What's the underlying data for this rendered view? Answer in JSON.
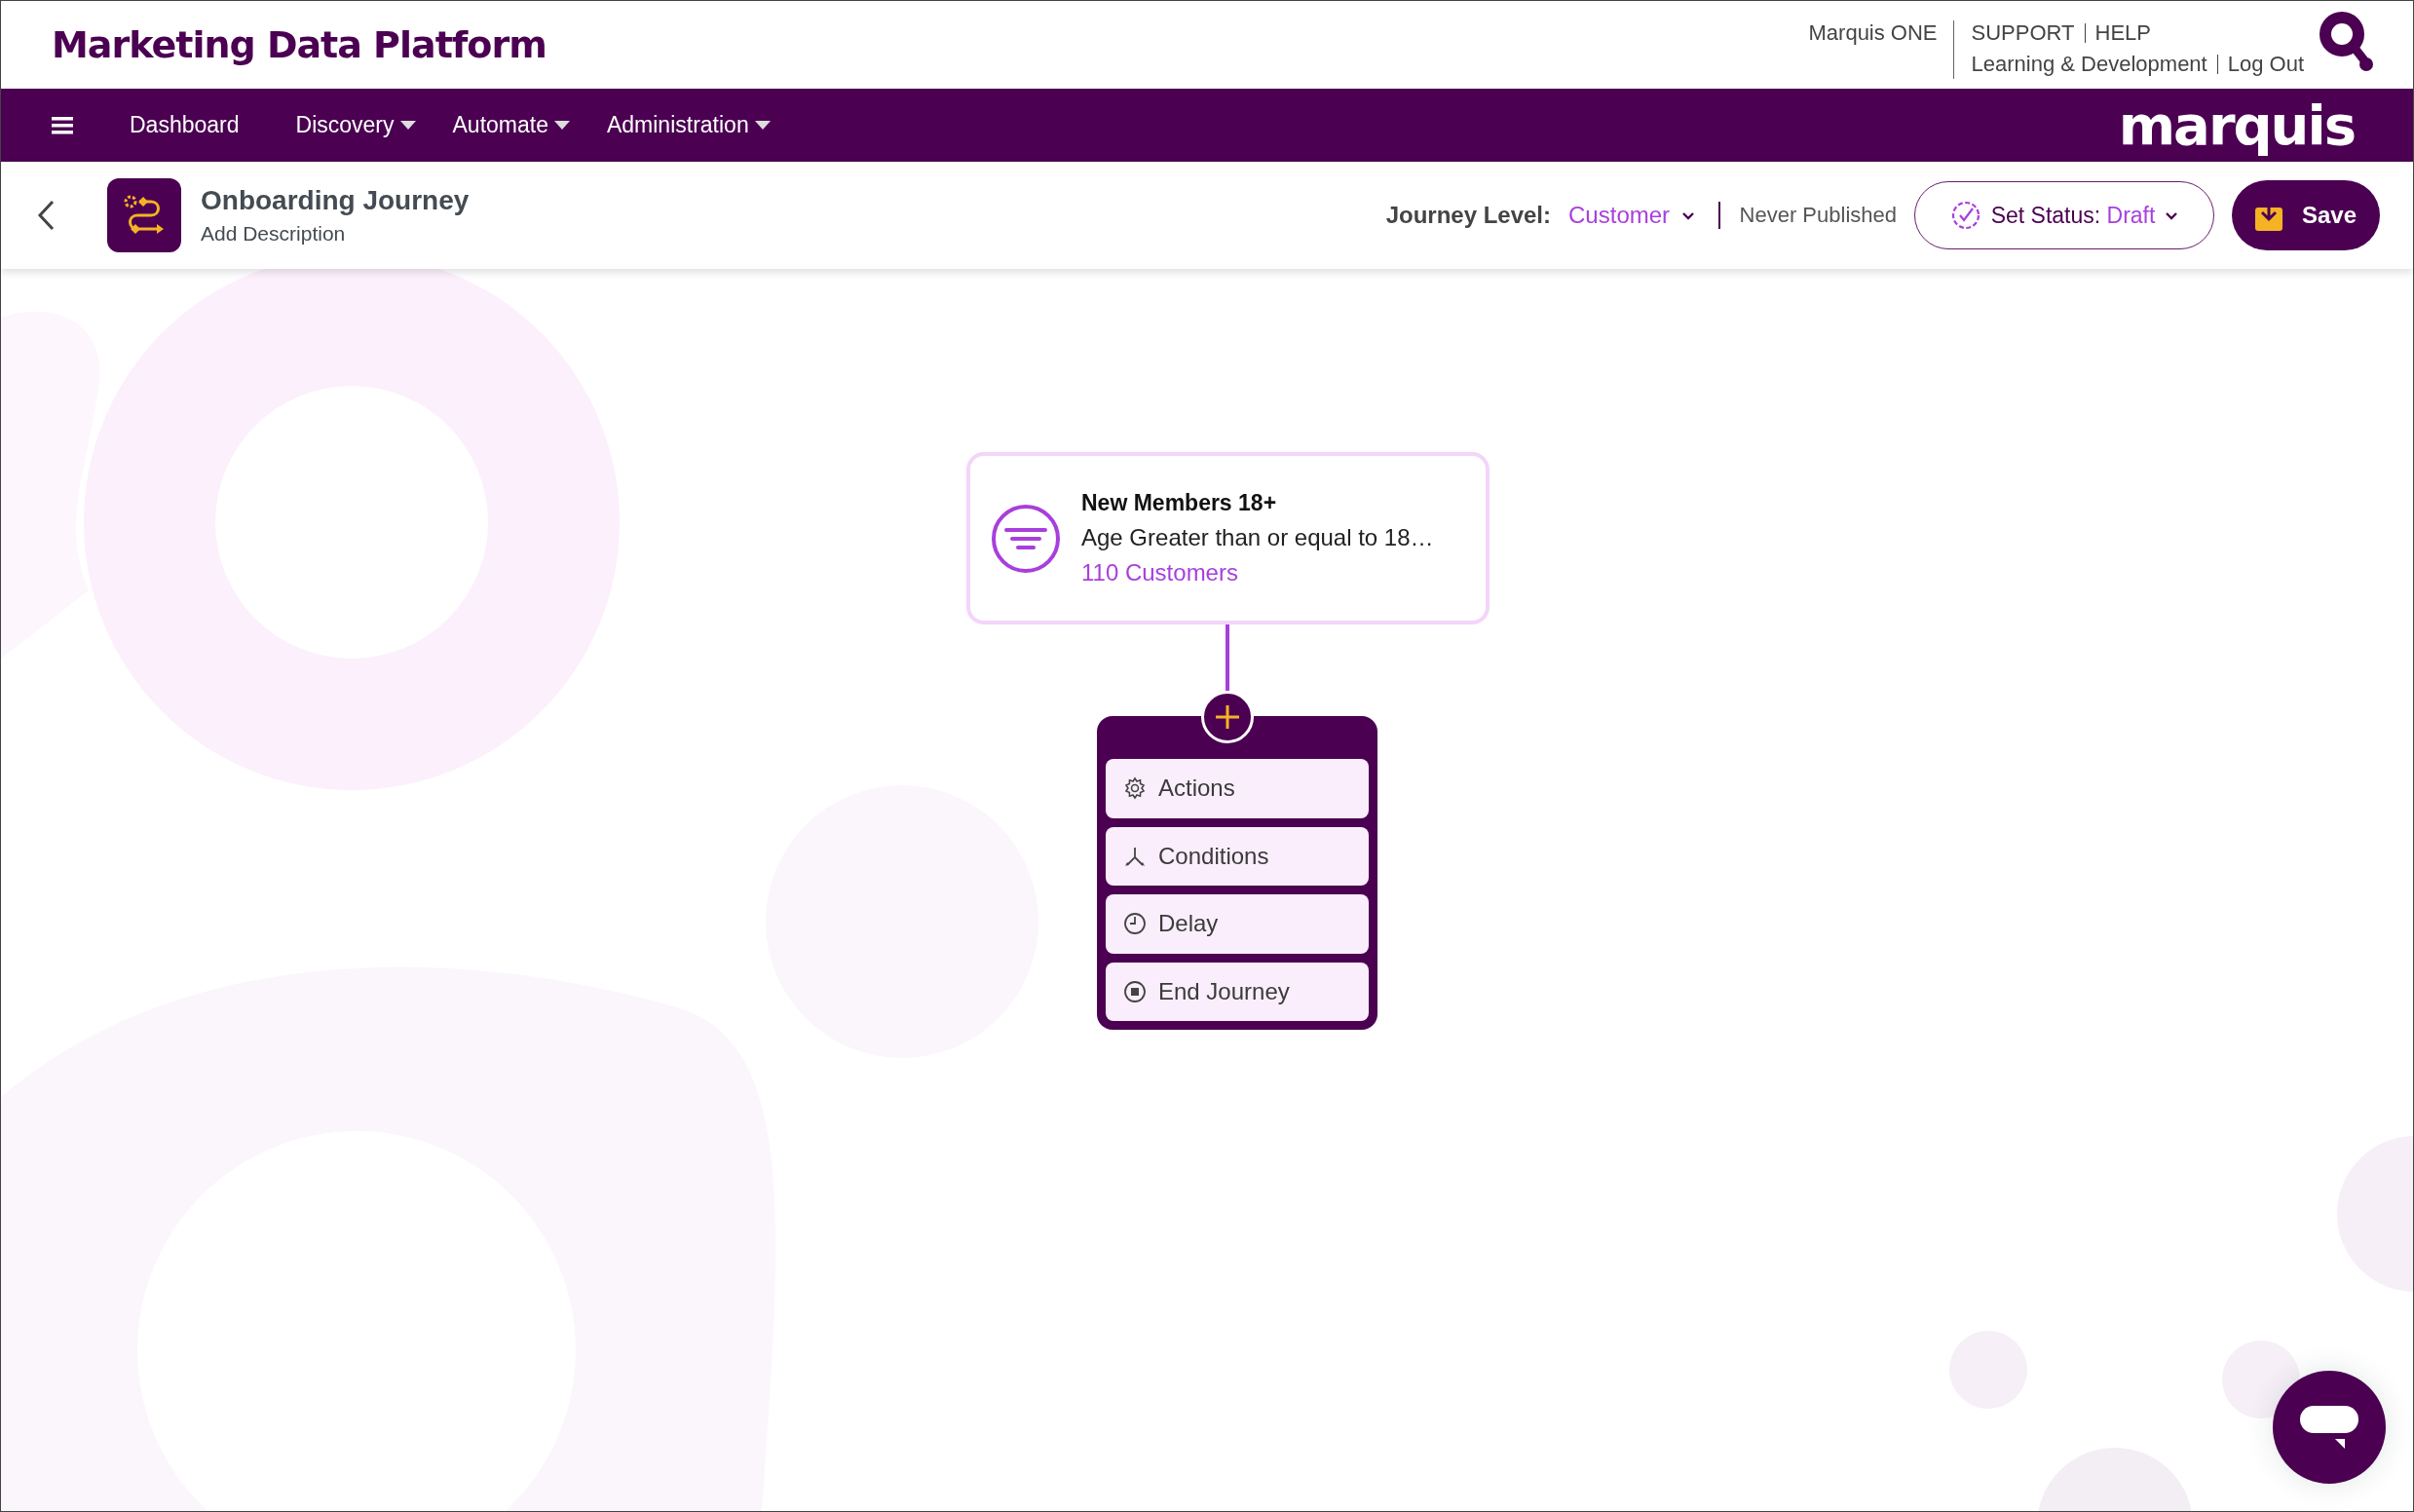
{
  "header": {
    "title": "Marketing Data Platform",
    "product": "Marquis ONE",
    "support_links": [
      "SUPPORT",
      "HELP"
    ],
    "account_links": [
      "Learning & Development",
      "Log Out"
    ]
  },
  "nav": {
    "items": [
      {
        "label": "Dashboard",
        "dropdown": false
      },
      {
        "label": "Discovery",
        "dropdown": true
      },
      {
        "label": "Automate",
        "dropdown": true
      },
      {
        "label": "Administration",
        "dropdown": true
      }
    ],
    "logo": "marquis"
  },
  "journey": {
    "title": "Onboarding Journey",
    "description": "Add Description",
    "level_label": "Journey Level:",
    "level": "Customer",
    "publish_state": "Never Published",
    "status_label": "Set Status:",
    "status": "Draft",
    "save": "Save"
  },
  "canvas": {
    "segment": {
      "title": "New Members 18+",
      "rule": "Age Greater than or equal to 18…",
      "count": "110 Customers"
    },
    "add_menu": {
      "expanded": true,
      "items": [
        {
          "kind": "actions",
          "label": "Actions"
        },
        {
          "kind": "conditions",
          "label": "Conditions"
        },
        {
          "kind": "delay",
          "label": "Delay"
        },
        {
          "kind": "end",
          "label": "End Journey"
        }
      ]
    }
  }
}
